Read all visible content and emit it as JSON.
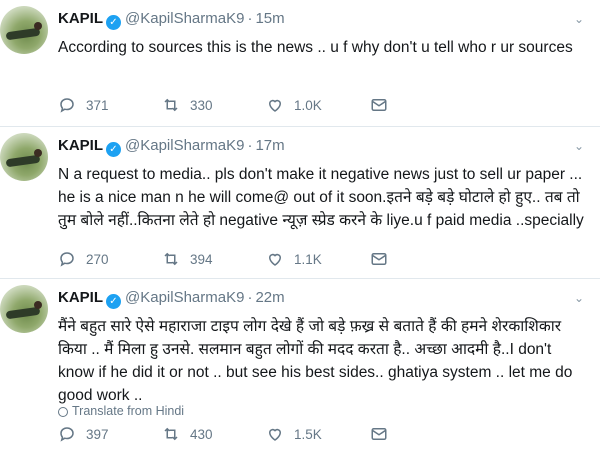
{
  "tweets": [
    {
      "name": "KAPIL",
      "handle": "@KapilSharmaK9",
      "time": "15m",
      "text": "According to sources this is the news .. u   f   why don't u tell who r ur sources",
      "replies": "371",
      "retweets": "330",
      "likes": "1.0K"
    },
    {
      "name": "KAPIL",
      "handle": "@KapilSharmaK9",
      "time": "17m",
      "text": "N a request to media.. pls don't make it negative news just to sell ur paper ... he is a nice man n he will come@ out of it soon.इतने बड़े बड़े घोटाले हो हुए.. तब तो तुम बोले नहीं..कितना लेते हो negative न्यूज़ स्प्रेड करने के liye.u f paid media ..specially",
      "replies": "270",
      "retweets": "394",
      "likes": "1.1K"
    },
    {
      "name": "KAPIL",
      "handle": "@KapilSharmaK9",
      "time": "22m",
      "text": "मैंने बहुत सारे ऐसे महाराजा टाइप लोग देखे हैं जो बड़े फ़ख्र से बताते हैं की हमने शेरकाशिकार किया .. मैं मिला हु उनसे. सलमान बहुत लोगों की मदद करता है.. अच्छा आदमी है..I don't know if he did it or not .. but see his best sides.. ghatiya system .. let me do good work ..",
      "translate": "Translate from Hindi",
      "replies": "397",
      "retweets": "430",
      "likes": "1.5K"
    }
  ],
  "colors": {
    "verified": "#1da1f2",
    "muted": "#657786",
    "divider": "#e1e8ed"
  },
  "icons": [
    "reply-icon",
    "retweet-icon",
    "like-icon",
    "message-icon",
    "chevron-down-icon",
    "verified-badge-icon",
    "globe-icon"
  ]
}
